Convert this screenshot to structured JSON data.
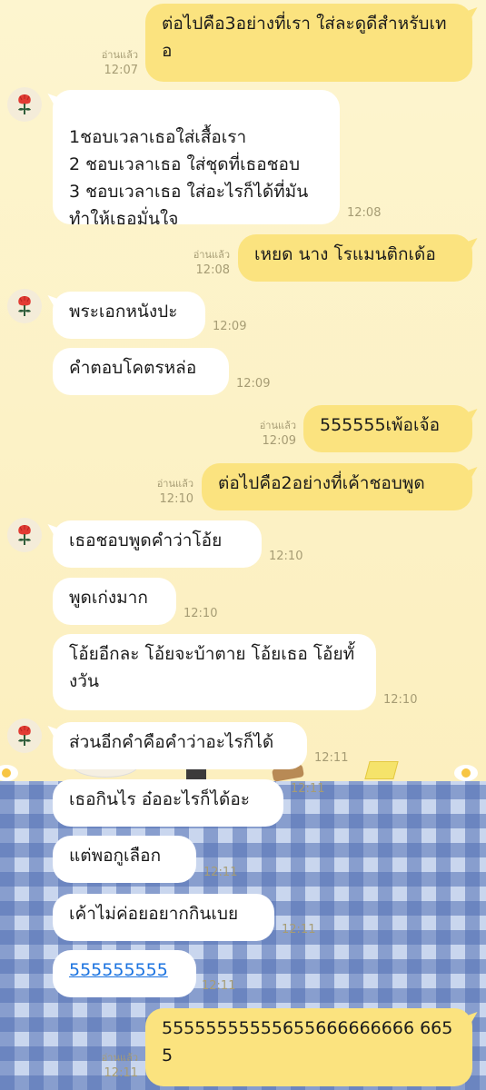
{
  "read_label": "อ่านแล้ว",
  "messages": [
    {
      "text": "ต่อไปคือ3อย่างที่เรา ใส่ละดูดีสำหรับเทอ",
      "time": "12:07"
    },
    {
      "text": "1ชอบเวลาเธอใส่เสื้อเรา\n2 ชอบเวลาเธอ ใส่ชุดที่เธอชอบ\n3 ชอบเวลาเธอ ใส่อะไรก็ได้ที่มัน ทำให้เธอมั่นใจ",
      "time": "12:08"
    },
    {
      "text": "เหยด นาง โรแมนติกเด้อ",
      "time": "12:08"
    },
    {
      "text": "พระเอกหนังปะ",
      "time": "12:09"
    },
    {
      "text": "คำตอบโคตรหล่อ",
      "time": "12:09"
    },
    {
      "text": "555555เพ้อเจ้อ",
      "time": "12:09"
    },
    {
      "text": "ต่อไปคือ2อย่างที่เค้าชอบพูด",
      "time": "12:10"
    },
    {
      "text": "เธอชอบพูดคำว่าโอ้ย",
      "time": "12:10"
    },
    {
      "text": "พูดเก่งมาก",
      "time": "12:10"
    },
    {
      "text": "โอ้ยอีกละ โอ้ยจะบ้าตาย โอ้ยเธอ โอ้ยทั้งวัน",
      "time": "12:10"
    },
    {
      "text": "ส่วนอีกคำคือคำว่าอะไรก็ได้",
      "time": "12:11"
    },
    {
      "text": "เธอกินไร อ๋ออะไรก็ได้อะ",
      "time": "12:11"
    },
    {
      "text": "แต่พอกูเลือก",
      "time": "12:11"
    },
    {
      "text": "เค้าไม่ค่อยอยากกินเบย",
      "time": "12:11"
    },
    {
      "text": "555555555",
      "time": "12:11"
    },
    {
      "text": "55555555555655666666666 6655",
      "time": "12:11"
    }
  ]
}
